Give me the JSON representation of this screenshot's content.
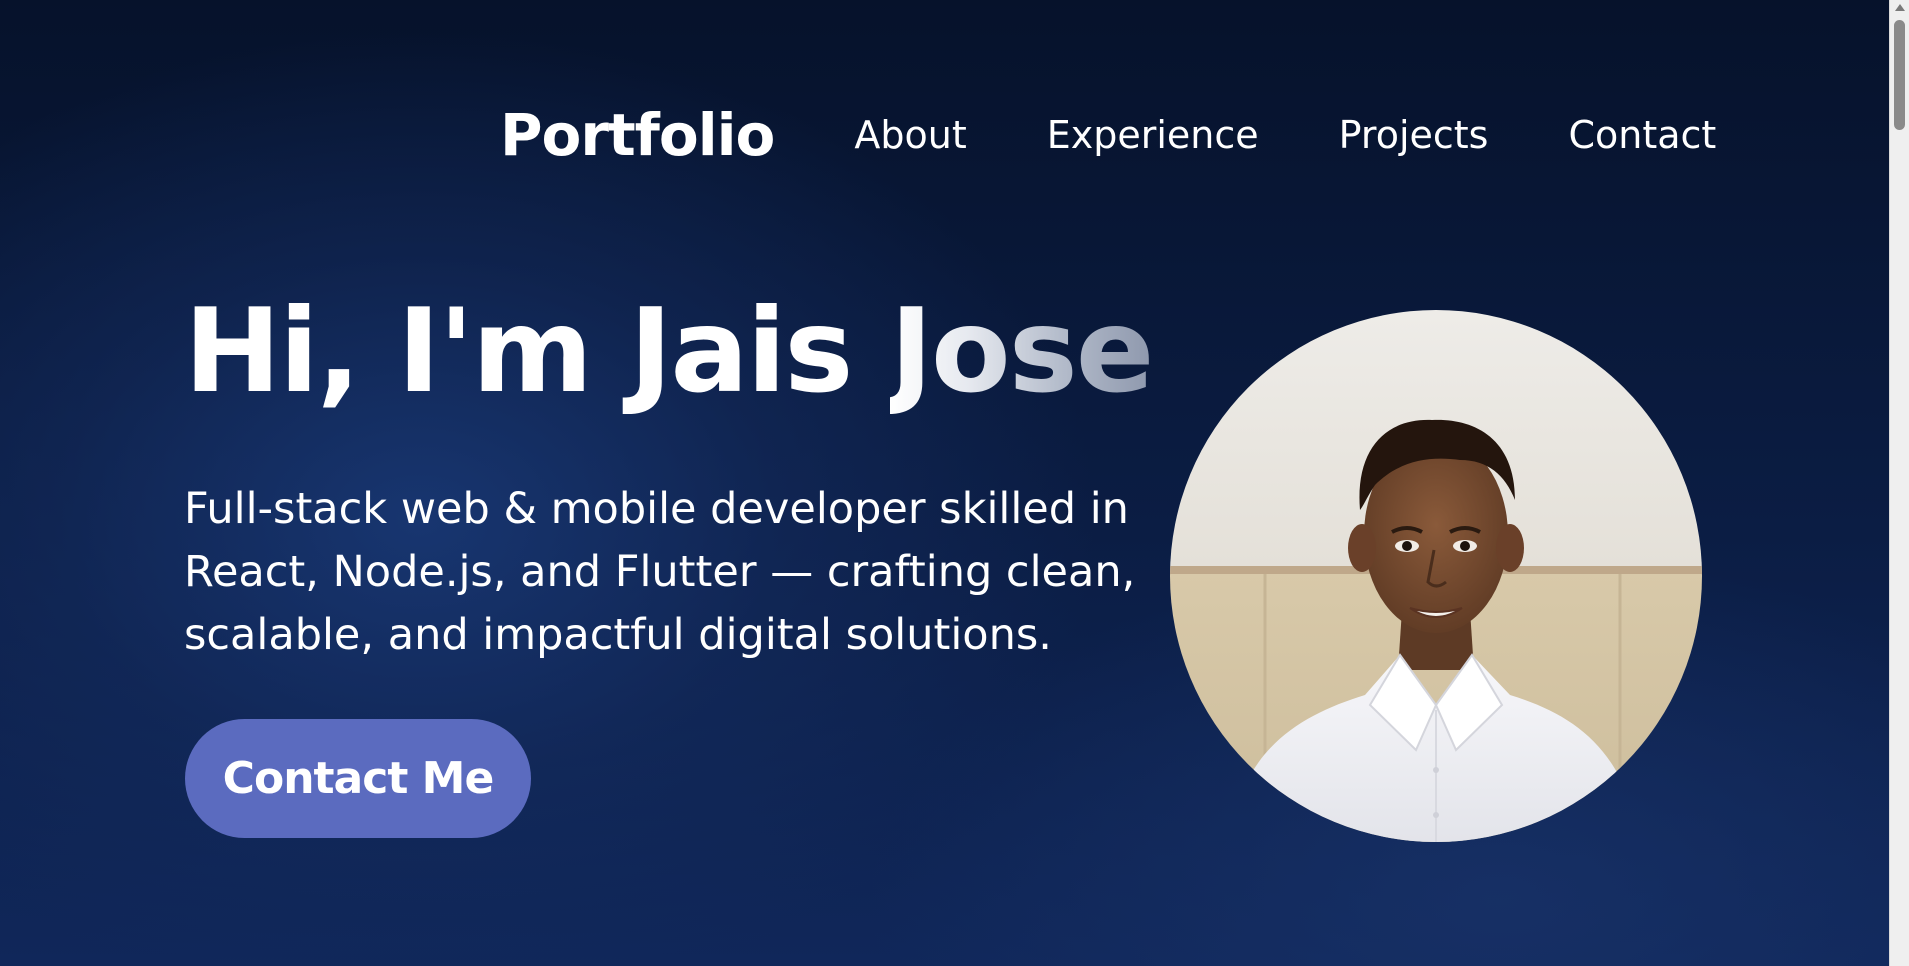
{
  "nav": {
    "brand": "Portfolio",
    "links": [
      {
        "label": "About"
      },
      {
        "label": "Experience"
      },
      {
        "label": "Projects"
      },
      {
        "label": "Contact"
      }
    ]
  },
  "hero": {
    "title_plain": "Hi, I'm Jais ",
    "title_highlight": "Jose",
    "description": "Full-stack web & mobile developer skilled in React, Node.js, and Flutter — crafting clean, scalable, and impactful digital solutions.",
    "cta_label": "Contact Me",
    "avatar_icon": "profile-photo"
  },
  "colors": {
    "background": "#0b1d44",
    "cta": "#5b6bbf",
    "text": "#ffffff"
  }
}
